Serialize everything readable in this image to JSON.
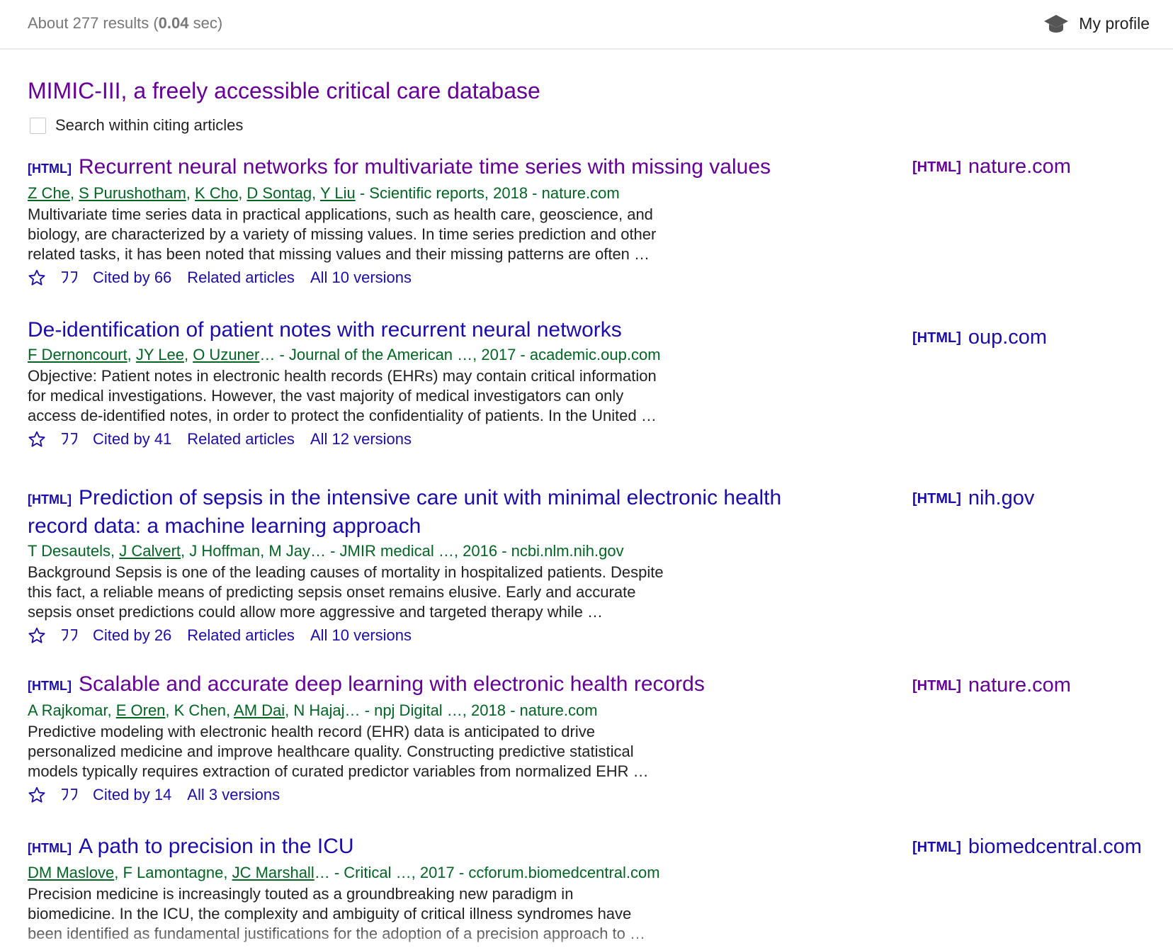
{
  "header": {
    "stats_prefix": "About 277 results (",
    "stats_time": "0.04",
    "stats_suffix": " sec)",
    "profile_label": "My profile",
    "profile_icon": "graduation-cap-icon"
  },
  "cited_article": {
    "title": "MIMIC-III, a freely accessible critical care database",
    "search_within_label": "Search within citing articles"
  },
  "colors": {
    "link": "#1a0dab",
    "visited": "#660099",
    "green": "#006621",
    "text": "#222222",
    "muted": "#777777"
  },
  "results": [
    {
      "tag": "[HTML]",
      "title_lines": [
        "Recurrent neural networks for multivariate time series with missing values"
      ],
      "authors": [
        "Z Che",
        "S Purushotham",
        "K Cho",
        "D Sontag",
        "Y Liu"
      ],
      "source": " - Scientific reports, 2018 - nature.com",
      "snippet": [
        "Multivariate time series data in practical applications, such as health care, geoscience, and",
        "biology, are characterized by a variety of missing values. In time series prediction and other",
        "related tasks, it has been noted that missing values and their missing patterns are often …"
      ],
      "cited_by": "Cited by 66",
      "related": "Related articles",
      "versions": "All 10 versions",
      "side_tag": "[HTML]",
      "side_domain": "nature.com"
    },
    {
      "tag": "",
      "title_lines": [
        "De-identification of patient notes with recurrent neural networks"
      ],
      "authors": [
        "F Dernoncourt",
        "JY Lee",
        "O Uzuner"
      ],
      "source": "… - Journal of the American …, 2017 - academic.oup.com",
      "snippet": [
        "Objective: Patient notes in electronic health records (EHRs) may contain critical information",
        "for medical investigations. However, the vast majority of medical investigators can only",
        "access de-identified notes, in order to protect the confidentiality of patients. In the United …"
      ],
      "cited_by": "Cited by 41",
      "related": "Related articles",
      "versions": "All 12 versions",
      "side_tag": "[HTML]",
      "side_domain": "oup.com"
    },
    {
      "tag": "[HTML]",
      "title_lines": [
        "Prediction of sepsis in the intensive care unit with minimal electronic health",
        "record data: a machine learning approach"
      ],
      "authors_mixed": [
        {
          "text": "T Desautels, ",
          "link": false
        },
        {
          "text": "J Calvert",
          "link": true
        },
        {
          "text": ", J Hoffman, M Jay",
          "link": false
        }
      ],
      "source": "… - JMIR medical …, 2016 - ncbi.nlm.nih.gov",
      "snippet": [
        "Background Sepsis is one of the leading causes of mortality in hospitalized patients. Despite",
        "this fact, a reliable means of predicting sepsis onset remains elusive. Early and accurate",
        "sepsis onset predictions could allow more aggressive and targeted therapy while …"
      ],
      "cited_by": "Cited by 26",
      "related": "Related articles",
      "versions": "All 10 versions",
      "side_tag": "[HTML]",
      "side_domain": "nih.gov"
    },
    {
      "tag": "[HTML]",
      "title_lines": [
        "Scalable and accurate deep learning with electronic health records"
      ],
      "authors_mixed": [
        {
          "text": "A Rajkomar, ",
          "link": false
        },
        {
          "text": "E Oren",
          "link": true
        },
        {
          "text": ", K Chen, ",
          "link": false
        },
        {
          "text": "AM Dai",
          "link": true
        },
        {
          "text": ", N Hajaj",
          "link": false
        }
      ],
      "source": "… - npj Digital …, 2018 - nature.com",
      "snippet": [
        "Predictive modeling with electronic health record (EHR) data is anticipated to drive",
        "personalized medicine and improve healthcare quality. Constructing predictive statistical",
        "models typically requires extraction of curated predictor variables from normalized EHR …"
      ],
      "cited_by": "Cited by 14",
      "versions": "All 3 versions",
      "side_tag": "[HTML]",
      "side_domain": "nature.com"
    },
    {
      "tag": "[HTML]",
      "title_lines": [
        "A path to precision in the ICU"
      ],
      "authors_mixed": [
        {
          "text": "DM Maslove",
          "link": true
        },
        {
          "text": ", F Lamontagne, ",
          "link": false
        },
        {
          "text": "JC Marshall",
          "link": true
        }
      ],
      "source": "… - Critical …, 2017 - ccforum.biomedcentral.com",
      "snippet": [
        "Precision medicine is increasingly touted as a groundbreaking new paradigm in",
        "biomedicine. In the ICU, the complexity and ambiguity of critical illness syndromes have",
        "been identified as fundamental justifications for the adoption of a precision approach to …"
      ],
      "side_tag": "[HTML]",
      "side_domain": "biomedcentral.com"
    }
  ]
}
